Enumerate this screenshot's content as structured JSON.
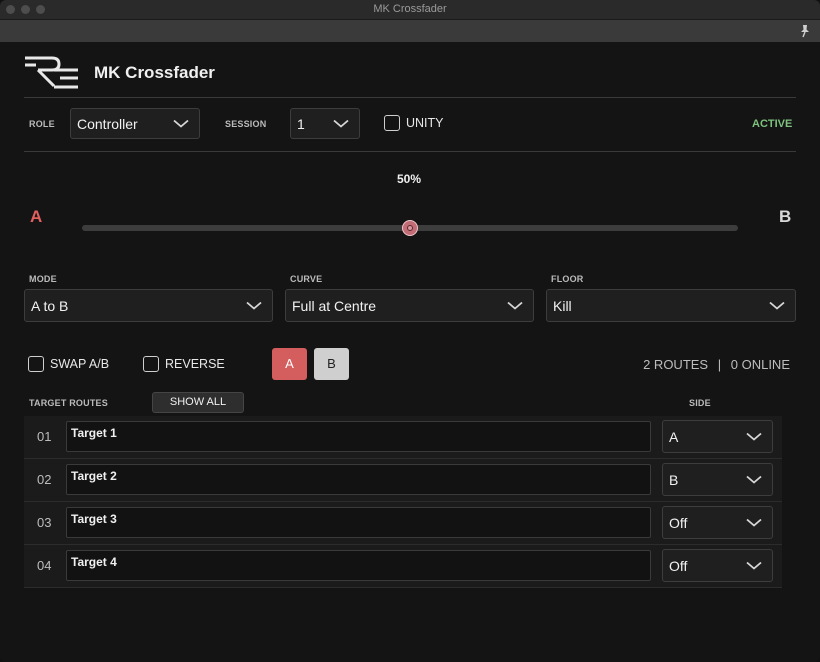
{
  "window": {
    "title": "MK Crossfader"
  },
  "header": {
    "app_name": "MK Crossfader"
  },
  "role": {
    "label": "ROLE",
    "value": "Controller"
  },
  "session": {
    "label": "SESSION",
    "value": "1"
  },
  "unity": {
    "label": "UNITY",
    "checked": false
  },
  "status": {
    "text": "ACTIVE",
    "color": "#7ec27e"
  },
  "fader": {
    "percent_label": "50%",
    "value": 0.5,
    "side_a": "A",
    "side_b": "B"
  },
  "mode": {
    "label": "MODE",
    "value": "A to B"
  },
  "curve": {
    "label": "CURVE",
    "value": "Full at Centre"
  },
  "floor": {
    "label": "FLOOR",
    "value": "Kill"
  },
  "swap": {
    "label": "SWAP A/B",
    "checked": false
  },
  "reverse": {
    "label": "REVERSE",
    "checked": false
  },
  "buttons": {
    "a": "A",
    "b": "B"
  },
  "routes_status": {
    "routes": "2 ROUTES",
    "separator": "|",
    "online": "0 ONLINE"
  },
  "targets": {
    "label": "TARGET ROUTES",
    "show_all": "SHOW ALL",
    "side_label": "SIDE",
    "rows": [
      {
        "num": "01",
        "name": "Target 1",
        "side": "A"
      },
      {
        "num": "02",
        "name": "Target 2",
        "side": "B"
      },
      {
        "num": "03",
        "name": "Target 3",
        "side": "Off"
      },
      {
        "num": "04",
        "name": "Target 4",
        "side": "Off"
      }
    ]
  },
  "colors": {
    "accent_a": "#e06060",
    "button_a": "#d45d5d",
    "button_b": "#cfcfcf",
    "thumb": "#c26c75"
  }
}
